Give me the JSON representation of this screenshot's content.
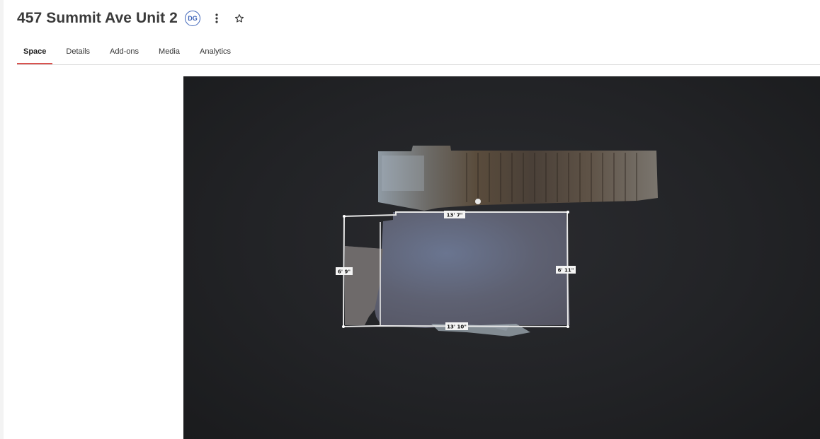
{
  "header": {
    "title": "457 Summit Ave Unit 2",
    "badge": "DG",
    "more_icon": "more-vertical-icon",
    "favorite_icon": "star-outline-icon"
  },
  "tabs": [
    {
      "label": "Space",
      "active": true
    },
    {
      "label": "Details",
      "active": false
    },
    {
      "label": "Add-ons",
      "active": false
    },
    {
      "label": "Media",
      "active": false
    },
    {
      "label": "Analytics",
      "active": false
    }
  ],
  "floorplan": {
    "measurements": {
      "top": "13' 7\"",
      "left": "6' 9\"",
      "right": "6' 11\"",
      "bottom": "13' 10\""
    }
  },
  "colors": {
    "accent": "#d9534f",
    "badge": "#3b62b8",
    "viewer_bg": "#222326"
  }
}
